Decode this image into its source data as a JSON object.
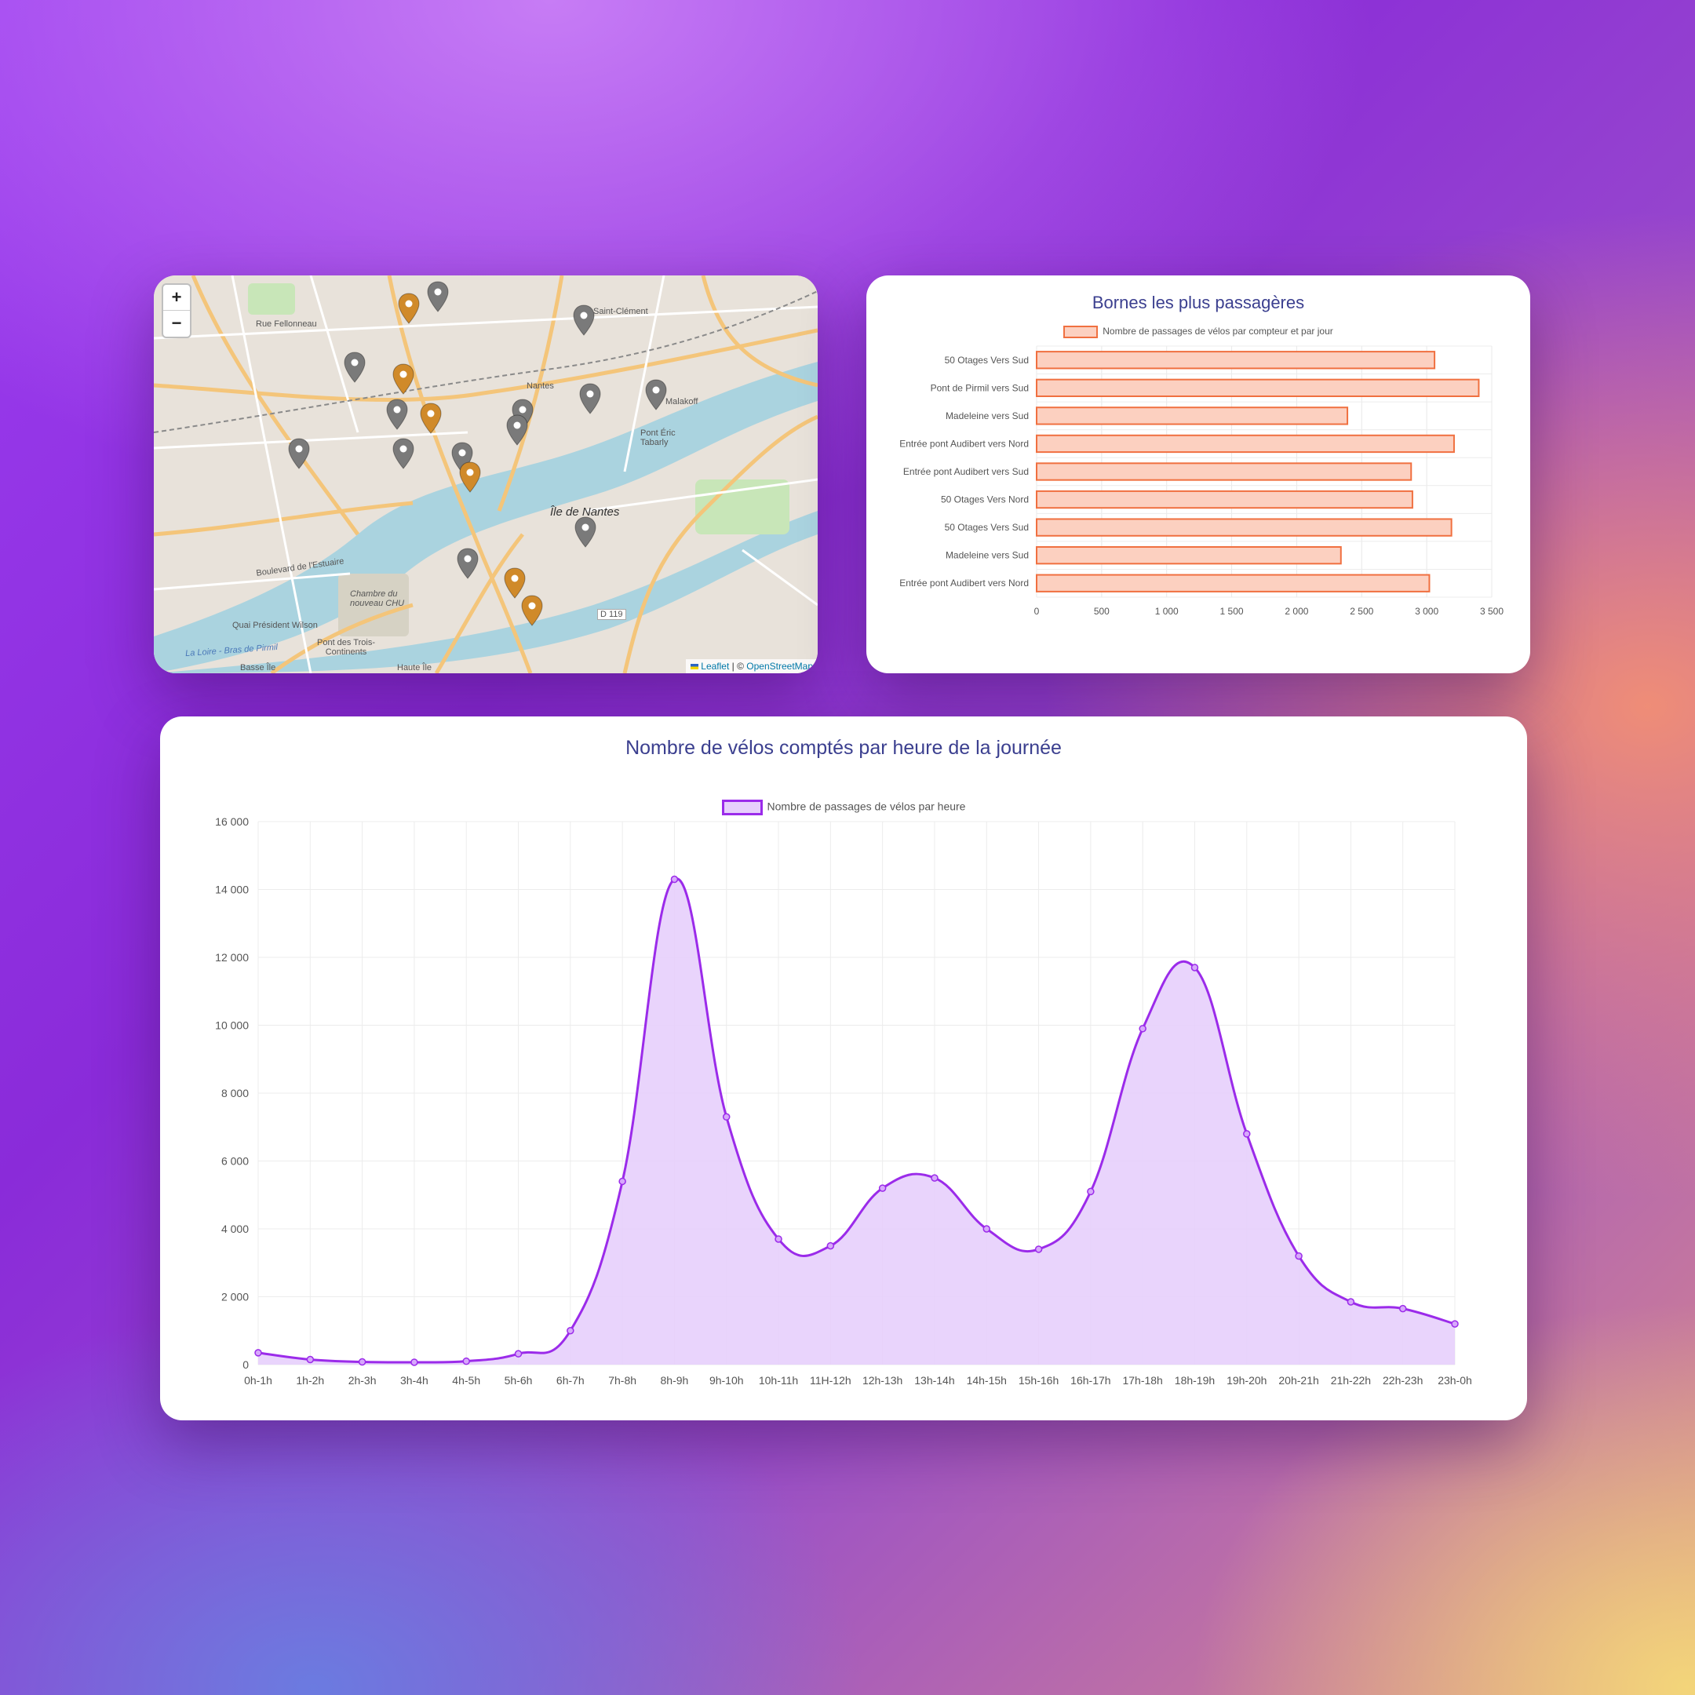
{
  "map": {
    "zoom_in": "+",
    "zoom_out": "−",
    "attribution_leaflet": "Leaflet",
    "attribution_sep": " | © ",
    "attribution_osm": "OpenStreetMap",
    "labels": {
      "saint_clement": "Saint-Clément",
      "nantes": "Nantes",
      "malakoff": "Malakoff",
      "ile_de_nantes": "Île de Nantes",
      "pont_eric_tabarly": "Pont Éric Tabarly",
      "boulevard_estuaire": "Boulevard de l'Estuaire",
      "quai_president_wilson": "Quai Président Wilson",
      "pont_trois_continents": "Pont des Trois-Continents",
      "d119": "D 119",
      "basse_ile": "Basse Île",
      "haute_ile": "Haute Île",
      "rue_fellonneau": "Rue Fellonneau",
      "la_loire": "La Loire - Bras de Pirmil",
      "chambre_nouveau_chu": "Chambre du nouveau CHU"
    },
    "marker_colors": {
      "orange": "#d08a2a",
      "gray": "#7a7a7a"
    }
  },
  "bar_chart": {
    "chart_data": {
      "type": "bar",
      "orientation": "horizontal",
      "title": "Bornes les plus passagères",
      "categories": [
        "50 Otages Vers Sud",
        "Pont de Pirmil vers Sud",
        "Madeleine vers Sud",
        "Entrée pont Audibert vers Nord",
        "Entrée pont Audibert vers Sud",
        "50 Otages Vers Nord",
        "50 Otages Vers Sud",
        "Madeleine vers Sud",
        "Entrée pont Audibert vers Nord"
      ],
      "series": [
        {
          "name": "Nombre de passages de vélos par compteur et par jour",
          "values": [
            3060,
            3400,
            2390,
            3210,
            2880,
            2890,
            3190,
            2340,
            3020
          ]
        }
      ],
      "xlim": [
        0,
        3500
      ],
      "xticks": [
        "0",
        "500",
        "1 000",
        "1 500",
        "2 000",
        "2 500",
        "3 000",
        "3 500"
      ],
      "grid": true,
      "legend": "top"
    },
    "colors": {
      "fill": "#fcd0c0",
      "stroke": "#f07040"
    }
  },
  "line_chart": {
    "chart_data": {
      "type": "area",
      "title": "Nombre de vélos comptés par heure de la journée",
      "categories": [
        "0h-1h",
        "1h-2h",
        "2h-3h",
        "3h-4h",
        "4h-5h",
        "5h-6h",
        "6h-7h",
        "7h-8h",
        "8h-9h",
        "9h-10h",
        "10h-11h",
        "11H-12h",
        "12h-13h",
        "13h-14h",
        "14h-15h",
        "15h-16h",
        "16h-17h",
        "17h-18h",
        "18h-19h",
        "19h-20h",
        "20h-21h",
        "21h-22h",
        "22h-23h",
        "23h-0h"
      ],
      "series": [
        {
          "name": "Nombre de passages de vélos par heure",
          "values": [
            350,
            150,
            80,
            70,
            100,
            320,
            1000,
            5400,
            14300,
            7300,
            3700,
            3500,
            5200,
            5500,
            4000,
            3400,
            5100,
            9900,
            11700,
            6800,
            3200,
            1850,
            1650,
            1200
          ]
        }
      ],
      "ylim": [
        0,
        16000
      ],
      "yticks": [
        "0",
        "2 000",
        "4 000",
        "6 000",
        "8 000",
        "10 000",
        "12 000",
        "14 000",
        "16 000"
      ],
      "grid": true,
      "legend": "top"
    },
    "colors": {
      "fill": "#e7cffc",
      "stroke": "#9b2bea"
    }
  }
}
